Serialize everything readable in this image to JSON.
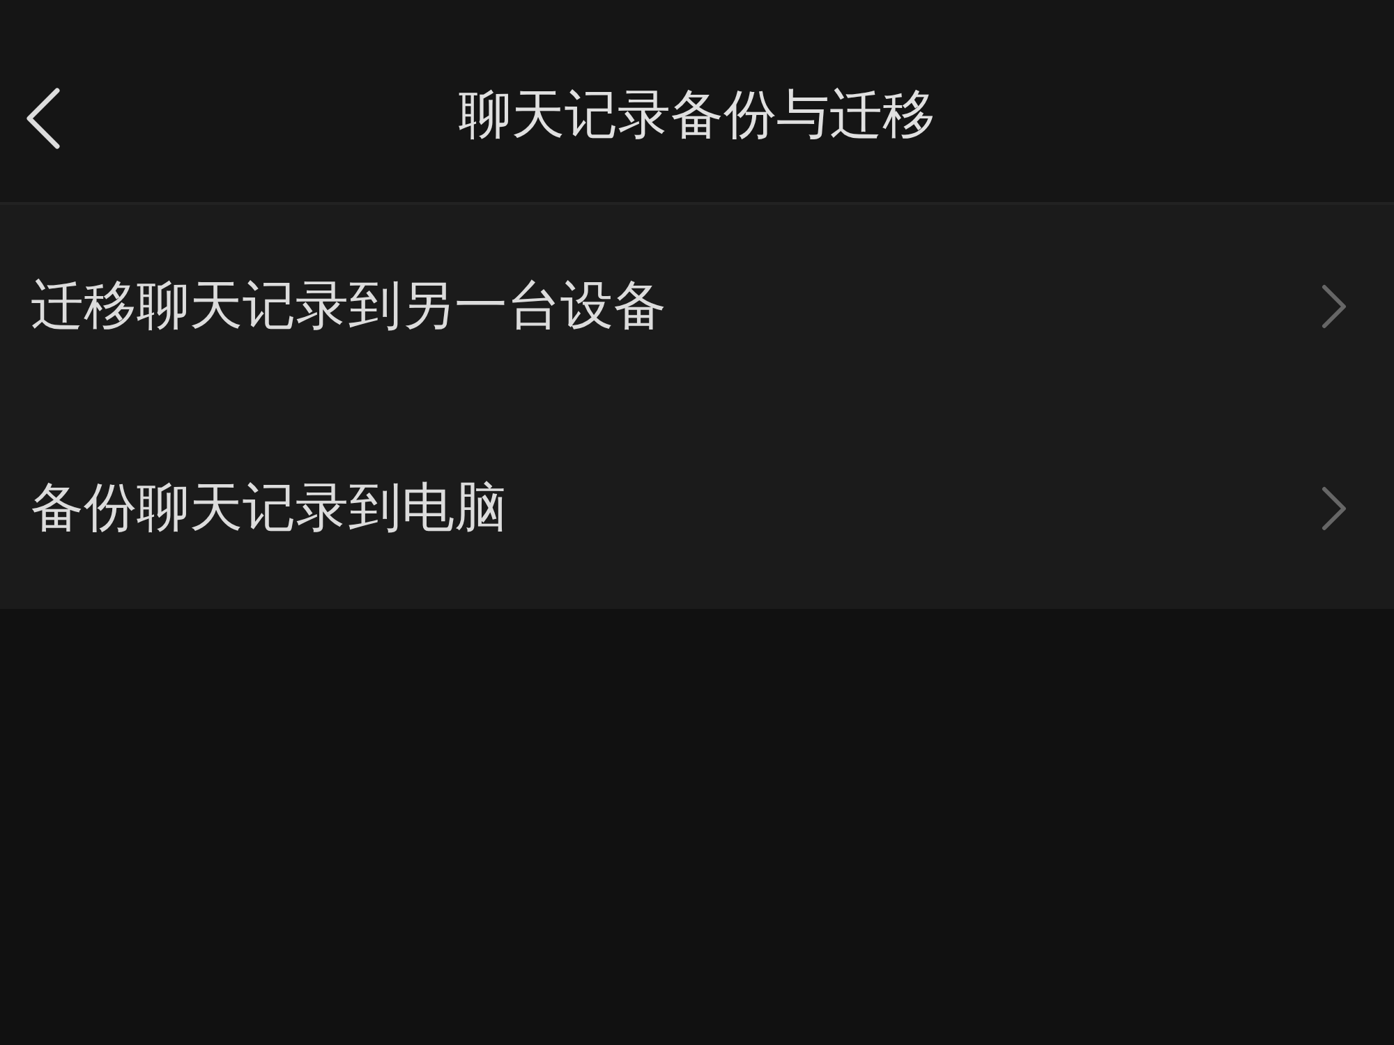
{
  "header": {
    "title": "聊天记录备份与迁移"
  },
  "items": [
    {
      "label": "迁移聊天记录到另一台设备"
    },
    {
      "label": "备份聊天记录到电脑"
    }
  ]
}
